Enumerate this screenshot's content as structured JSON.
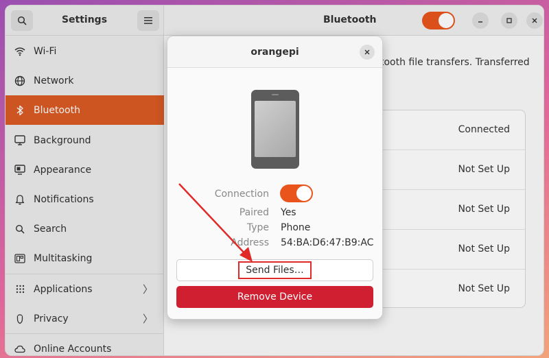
{
  "sidebar": {
    "title": "Settings",
    "items": [
      {
        "label": "Wi-Fi",
        "icon": "wifi-icon"
      },
      {
        "label": "Network",
        "icon": "network-icon"
      },
      {
        "label": "Bluetooth",
        "icon": "bluetooth-icon",
        "active": true
      },
      {
        "label": "Background",
        "icon": "background-icon"
      },
      {
        "label": "Appearance",
        "icon": "appearance-icon"
      },
      {
        "label": "Notifications",
        "icon": "bell-icon"
      },
      {
        "label": "Search",
        "icon": "search-icon"
      },
      {
        "label": "Multitasking",
        "icon": "multitasking-icon"
      },
      {
        "label": "Applications",
        "icon": "applications-icon"
      },
      {
        "label": "Privacy",
        "icon": "privacy-icon"
      },
      {
        "label": "Online Accounts",
        "icon": "cloud-icon"
      }
    ]
  },
  "main": {
    "title": "Bluetooth",
    "description": "tooth file transfers. Transferred",
    "devices": [
      {
        "status": "Connected"
      },
      {
        "status": "Not Set Up"
      },
      {
        "status": "Not Set Up"
      },
      {
        "status": "Not Set Up"
      },
      {
        "status": "Not Set Up"
      }
    ]
  },
  "dialog": {
    "title": "orangepi",
    "connection_label": "Connection",
    "connection_on": true,
    "paired_label": "Paired",
    "paired_value": "Yes",
    "type_label": "Type",
    "type_value": "Phone",
    "address_label": "Address",
    "address_value": "54:BA:D6:47:B9:AC",
    "send_files_label": "Send Files…",
    "remove_device_label": "Remove Device"
  },
  "colors": {
    "accent": "#e9541d",
    "sidebar_active": "#d95b25",
    "destructive": "#d01f31",
    "annotation": "#e02a2a"
  }
}
